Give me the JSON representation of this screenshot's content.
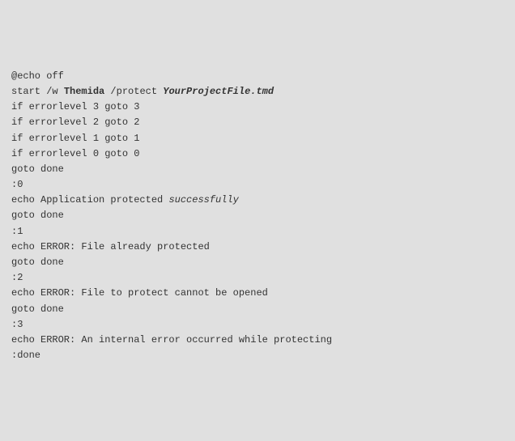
{
  "code": {
    "l01": "@echo off",
    "l02": "",
    "l03_a": "start /w ",
    "l03_b": "Themida",
    "l03_c": " /protect ",
    "l03_d": "YourProjectFile.tmd",
    "l04": "",
    "l05": "if errorlevel 3 goto 3",
    "l06": "if errorlevel 2 goto 2",
    "l07": "if errorlevel 1 goto 1",
    "l08": "if errorlevel 0 goto 0",
    "l09": "goto done",
    "l10": "",
    "l11": ":0",
    "l12_a": "echo Application protected ",
    "l12_b": "successfully",
    "l13": "goto done",
    "l14": "",
    "l15": ":1",
    "l16": "echo ERROR: File already protected",
    "l17": "goto done",
    "l18": "",
    "l19": ":2",
    "l20": "echo ERROR: File to protect cannot be opened",
    "l21": "goto done",
    "l22": "",
    "l23": ":3",
    "l24": "echo ERROR: An internal error occurred while protecting",
    "l25": "",
    "l26": ":done"
  }
}
